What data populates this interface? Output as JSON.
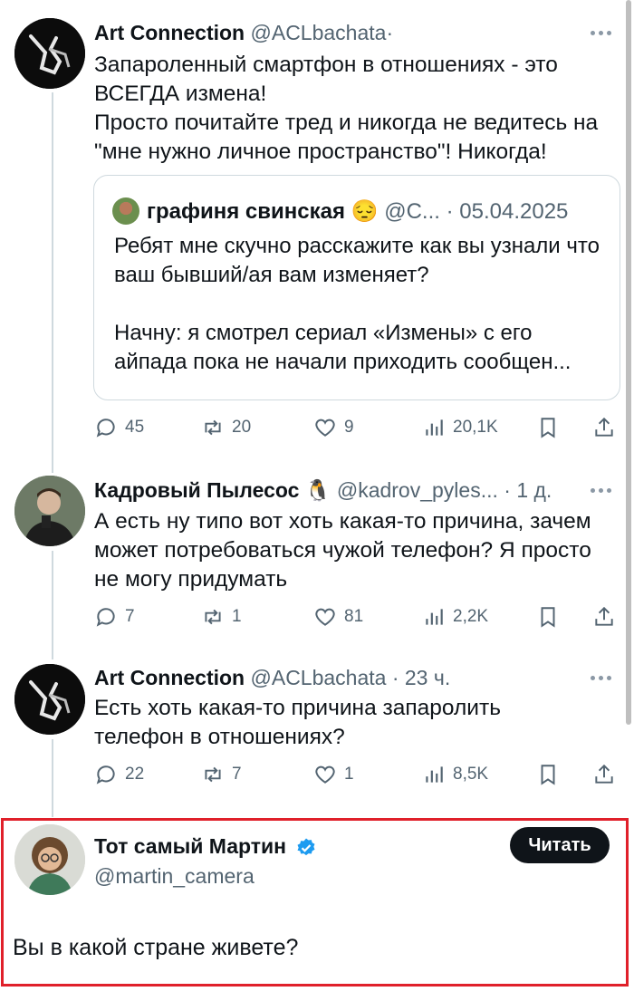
{
  "tweets": [
    {
      "name": "Art Connection",
      "handle": "@ACLbachata",
      "separator": "·",
      "time": "",
      "text": "Запароленный смартфон в отношениях - это ВСЕГДА измена!\nПросто почитайте тред и никогда не ведитесь на \"мне нужно личное пространство\"! Никогда!",
      "quote": {
        "name": "графиня свинская",
        "emoji": "😔",
        "handle": "@С...",
        "date": "· 05.04.2025",
        "text": "Ребят мне скучно расскажите как вы узнали что ваш бывший/ая вам изменяет?\n\nНачну: я смотрел сериал «Измены» с его айпада пока не начали приходить сообщен..."
      },
      "stats": {
        "replies": "45",
        "retweets": "20",
        "likes": "9",
        "views": "20,1K"
      }
    },
    {
      "name": "Кадровый Пылесос",
      "emoji": "🐧",
      "handle": "@kadrov_pyles...",
      "time": "· 1 д.",
      "text": "А есть ну типо вот хоть какая-то причина, зачем может потребоваться чужой телефон? Я просто не могу придумать",
      "stats": {
        "replies": "7",
        "retweets": "1",
        "likes": "81",
        "views": "2,2K"
      }
    },
    {
      "name": "Art Connection",
      "handle": "@ACLbachata",
      "time": "· 23 ч.",
      "text": "Есть хоть какая-то причина запаролить телефон в отношениях?",
      "stats": {
        "replies": "22",
        "retweets": "7",
        "likes": "1",
        "views": "8,5K"
      }
    }
  ],
  "focus": {
    "name": "Тот самый Мартин",
    "handle": "@martin_camera",
    "follow_label": "Читать",
    "text": "Вы в какой стране живете?"
  },
  "colors": {
    "text": "#0f1419",
    "muted": "#536471",
    "line": "#cfd9de",
    "verified": "#1d9bf0",
    "highlight": "#e0202a"
  },
  "icons": [
    "reply-icon",
    "retweet-icon",
    "like-icon",
    "views-icon",
    "bookmark-icon",
    "share-icon",
    "more-icon",
    "verified-icon"
  ]
}
